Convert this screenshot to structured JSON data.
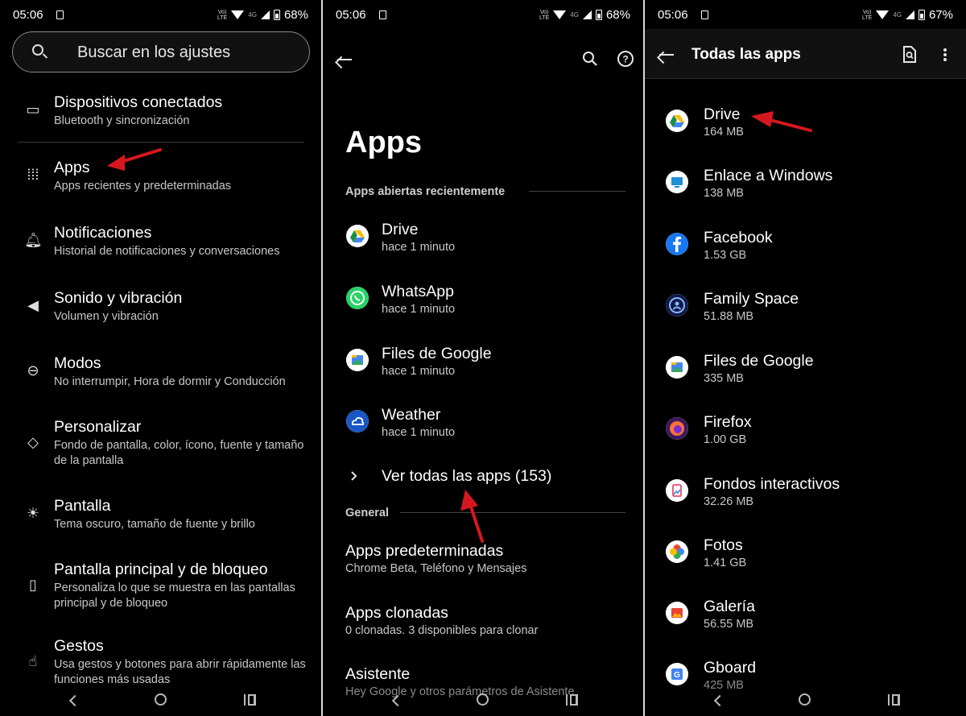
{
  "status_bars": [
    {
      "time": "05:06",
      "battery": "68%",
      "network": "4G"
    },
    {
      "time": "05:06",
      "battery": "68%",
      "network": "4G"
    },
    {
      "time": "05:06",
      "battery": "67%",
      "network": "4G"
    }
  ],
  "settings": {
    "search_placeholder": "Buscar en los ajustes",
    "items": [
      {
        "title": "Dispositivos conectados",
        "subtitle": "Bluetooth y sincronización",
        "icon": "devices-icon"
      },
      {
        "title": "Apps",
        "subtitle": "Apps recientes y predeterminadas",
        "icon": "apps-grid-icon"
      },
      {
        "title": "Notificaciones",
        "subtitle": "Historial de notificaciones y conversaciones",
        "icon": "bell-icon"
      },
      {
        "title": "Sonido y vibración",
        "subtitle": "Volumen y vibración",
        "icon": "volume-icon"
      },
      {
        "title": "Modos",
        "subtitle": "No interrumpir, Hora de dormir y Conducción",
        "icon": "modes-icon"
      },
      {
        "title": "Personalizar",
        "subtitle": "Fondo de pantalla, color, ícono, fuente y tamaño de la pantalla",
        "icon": "palette-icon"
      },
      {
        "title": "Pantalla",
        "subtitle": "Tema oscuro, tamaño de fuente y brillo",
        "icon": "brightness-icon"
      },
      {
        "title": "Pantalla principal y de bloqueo",
        "subtitle": "Personaliza lo que se muestra en las pantallas principal y de bloqueo",
        "icon": "lockscreen-icon"
      },
      {
        "title": "Gestos",
        "subtitle": "Usa gestos y botones para abrir rápidamente las funciones más usadas",
        "icon": "gesture-icon"
      }
    ]
  },
  "apps": {
    "title": "Apps",
    "recent_header": "Apps abiertas recientemente",
    "recent": [
      {
        "name": "Drive",
        "time": "hace 1 minuto",
        "icon": "drive-icon"
      },
      {
        "name": "WhatsApp",
        "time": "hace 1 minuto",
        "icon": "whatsapp-icon"
      },
      {
        "name": "Files de Google",
        "time": "hace 1 minuto",
        "icon": "files-icon"
      },
      {
        "name": "Weather",
        "time": "hace 1 minuto",
        "icon": "weather-icon"
      }
    ],
    "see_all": "Ver todas las apps (153)",
    "general_header": "General",
    "general": [
      {
        "title": "Apps predeterminadas",
        "subtitle": "Chrome Beta, Teléfono y Mensajes"
      },
      {
        "title": "Apps clonadas",
        "subtitle": "0 clonadas. 3 disponibles para clonar"
      },
      {
        "title": "Asistente",
        "subtitle": "Hey Google y otros parámetros de Asistente"
      }
    ]
  },
  "all_apps": {
    "title": "Todas las apps",
    "list": [
      {
        "name": "Drive",
        "size": "164 MB",
        "icon": "drive-icon",
        "color": "#1e8e3e"
      },
      {
        "name": "Enlace a Windows",
        "size": "138 MB",
        "icon": "windows-link-icon",
        "color": "#1e90d6"
      },
      {
        "name": "Facebook",
        "size": "1.53 GB",
        "icon": "facebook-icon",
        "color": "#1877f2"
      },
      {
        "name": "Family Space",
        "size": "51.88 MB",
        "icon": "family-space-icon",
        "color": "#1c2a6b"
      },
      {
        "name": "Files de Google",
        "size": "335 MB",
        "icon": "files-icon",
        "color": "#4285f4"
      },
      {
        "name": "Firefox",
        "size": "1.00 GB",
        "icon": "firefox-icon",
        "color": "#ff7139"
      },
      {
        "name": "Fondos interactivos",
        "size": "32.26 MB",
        "icon": "wallpapers-icon",
        "color": "#e94c6b"
      },
      {
        "name": "Fotos",
        "size": "1.41 GB",
        "icon": "photos-icon",
        "color": "#fbbc04"
      },
      {
        "name": "Galería",
        "size": "56.55 MB",
        "icon": "gallery-icon",
        "color": "#ea4335"
      },
      {
        "name": "Gboard",
        "size": "425 MB",
        "icon": "gboard-icon",
        "color": "#4285f4"
      }
    ]
  },
  "colors": {
    "background": "#000000",
    "annotation_arrow": "#d6181e"
  }
}
